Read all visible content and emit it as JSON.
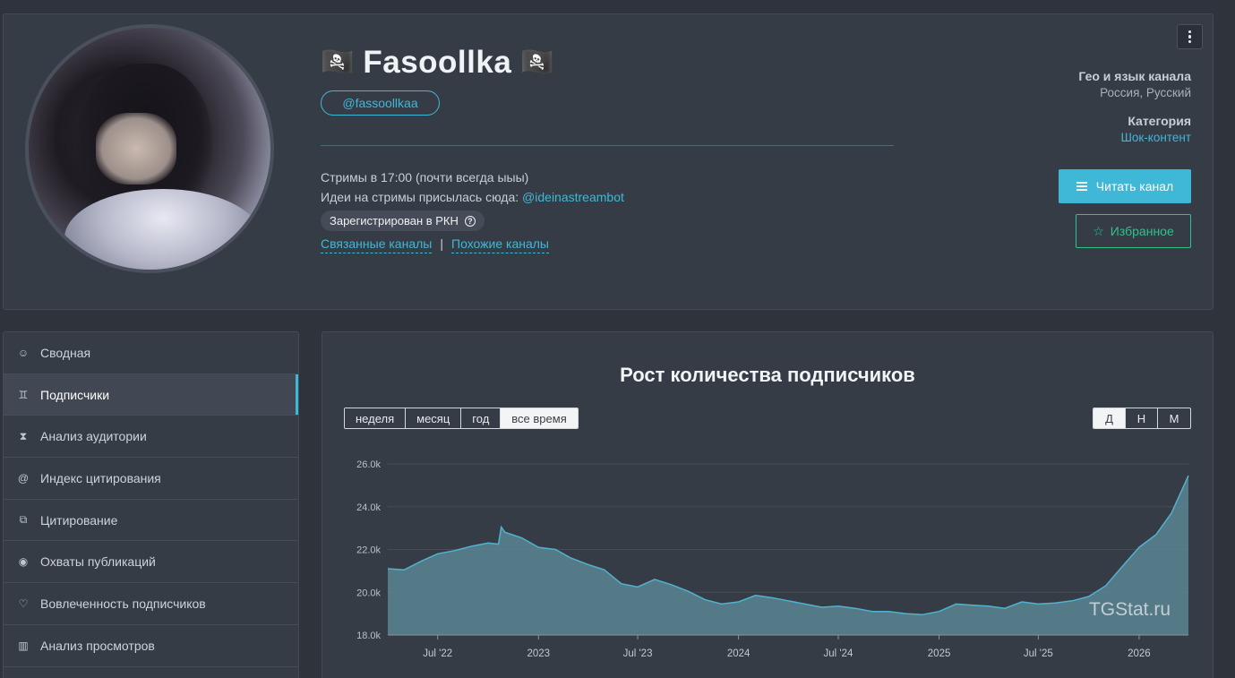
{
  "channel": {
    "flag_left": "🏴‍☠️",
    "title": "Fasoollka",
    "flag_right": "🏴‍☠️",
    "handle": "@fassoollkaa",
    "desc_line1": "Стримы в 17:00 (почти всегда ыыы)",
    "desc_line2_prefix": "Идеи на стримы присылась сюда: ",
    "desc_line2_link": "@ideinastreambot",
    "rkn_badge": "Зарегистрирован в РКН",
    "rkn_help": "?",
    "related_link": "Связанные каналы",
    "separator": "|",
    "similar_link": "Похожие каналы"
  },
  "meta": {
    "geo_label": "Гео и язык канала",
    "geo_value": "Россия, Русский",
    "category_label": "Категория",
    "category_value": "Шок-контент"
  },
  "actions": {
    "read_label": "Читать канал",
    "favorite_label": "Избранное",
    "favorite_icon": "☆"
  },
  "sidebar": {
    "items": [
      {
        "icon": "☺",
        "label": "Сводная"
      },
      {
        "icon": "♊",
        "label": "Подписчики",
        "active": true
      },
      {
        "icon": "⧗",
        "label": "Анализ аудитории"
      },
      {
        "icon": "@",
        "label": "Индекс цитирования"
      },
      {
        "icon": "⧉",
        "label": "Цитирование"
      },
      {
        "icon": "◉",
        "label": "Охваты публикаций"
      },
      {
        "icon": "♡",
        "label": "Вовлеченность подписчиков"
      },
      {
        "icon": "▥",
        "label": "Анализ просмотров"
      }
    ]
  },
  "chart_panel": {
    "title": "Рост количества подписчиков",
    "periods": [
      "неделя",
      "месяц",
      "год",
      "все время"
    ],
    "selected_period": "все время",
    "granularity": [
      "Д",
      "Н",
      "М"
    ],
    "selected_granularity": "Д",
    "watermark": "TGStat.ru"
  },
  "colors": {
    "accent": "#3fb8d8",
    "favorite": "#31c08e",
    "area_fill": "#5b8593",
    "area_line": "#4fb3cf"
  },
  "chart_data": {
    "type": "area",
    "title": "Рост количества подписчиков",
    "ylim": [
      18000,
      26000
    ],
    "y_ticks": [
      "18.0k",
      "20.0k",
      "22.0k",
      "24.0k",
      "26.0k"
    ],
    "x_ticks": [
      "Jul '22",
      "2023",
      "Jul '23",
      "2024",
      "Jul '24",
      "2025",
      "Jul '25",
      "2026"
    ],
    "x_range": [
      "2022-04",
      "2026-04"
    ],
    "series": [
      {
        "points": [
          [
            "2022-04",
            21100
          ],
          [
            "2022-05",
            21050
          ],
          [
            "2022-06",
            21450
          ],
          [
            "2022-07",
            21800
          ],
          [
            "2022-08",
            21950
          ],
          [
            "2022-09",
            22150
          ],
          [
            "2022-10",
            22300
          ],
          [
            "2022-10-20",
            22250
          ],
          [
            "2022-10-25",
            23050
          ],
          [
            "2022-11",
            22800
          ],
          [
            "2022-12",
            22550
          ],
          [
            "2023-01",
            22100
          ],
          [
            "2023-02",
            22000
          ],
          [
            "2023-03",
            21600
          ],
          [
            "2023-04",
            21300
          ],
          [
            "2023-05",
            21050
          ],
          [
            "2023-06",
            20400
          ],
          [
            "2023-07",
            20250
          ],
          [
            "2023-08",
            20600
          ],
          [
            "2023-09",
            20350
          ],
          [
            "2023-10",
            20050
          ],
          [
            "2023-11",
            19650
          ],
          [
            "2023-12",
            19450
          ],
          [
            "2024-01",
            19550
          ],
          [
            "2024-02",
            19850
          ],
          [
            "2024-03",
            19750
          ],
          [
            "2024-04",
            19600
          ],
          [
            "2024-05",
            19450
          ],
          [
            "2024-06",
            19300
          ],
          [
            "2024-07",
            19350
          ],
          [
            "2024-08",
            19250
          ],
          [
            "2024-09",
            19100
          ],
          [
            "2024-10",
            19100
          ],
          [
            "2024-11",
            19000
          ],
          [
            "2024-12",
            18950
          ],
          [
            "2025-01",
            19100
          ],
          [
            "2025-02",
            19450
          ],
          [
            "2025-03",
            19400
          ],
          [
            "2025-04",
            19350
          ],
          [
            "2025-05",
            19250
          ],
          [
            "2025-06",
            19550
          ],
          [
            "2025-07",
            19450
          ],
          [
            "2025-08",
            19500
          ],
          [
            "2025-09",
            19600
          ],
          [
            "2025-10",
            19800
          ],
          [
            "2025-11",
            20300
          ],
          [
            "2025-12",
            21200
          ],
          [
            "2026-01",
            22100
          ],
          [
            "2026-02",
            22700
          ],
          [
            "2026-03",
            23700
          ],
          [
            "2026-04",
            25450
          ]
        ]
      }
    ]
  }
}
